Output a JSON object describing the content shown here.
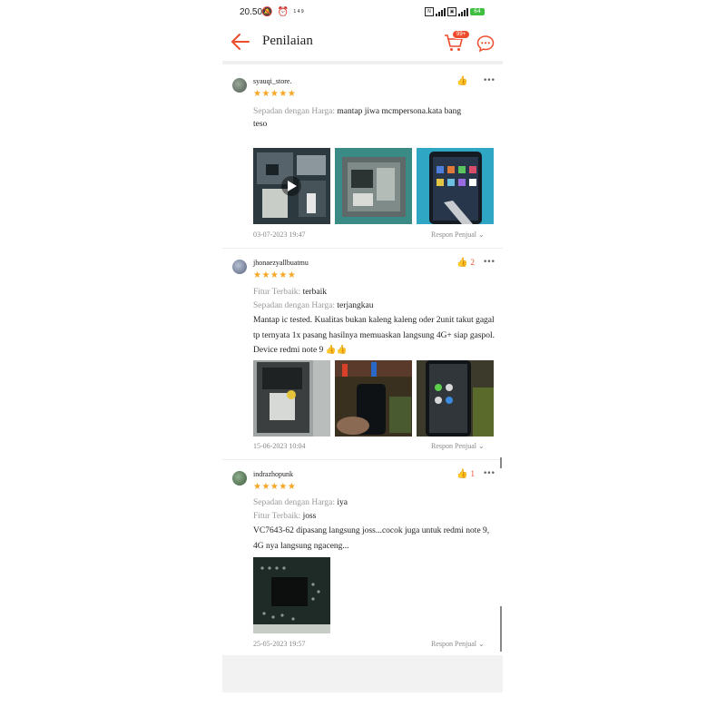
{
  "status_bar": {
    "time": "20.50",
    "indicator": "149",
    "battery": "64"
  },
  "header": {
    "title": "Penilaian",
    "cart_badge": "99+"
  },
  "reviews": [
    {
      "username": "syauqi_store.",
      "stars": "★★★★★",
      "rating_count": 5,
      "helpful_count": "",
      "lines": [
        {
          "key": "Sepadan dengan Harga:",
          "value": "mantap jiwa mcmpersona.kata bang"
        }
      ],
      "body": "teso",
      "date": "03-07-2023 19:47",
      "respon": "Respon Penjual"
    },
    {
      "username": "jhonaezyallbuatmu",
      "stars": "★★★★★",
      "rating_count": 5,
      "helpful_count": "2",
      "lines": [
        {
          "key": "Fitur Terbaik:",
          "value": "terbaik"
        },
        {
          "key": "Sepadan dengan Harga:",
          "value": "terjangkau"
        }
      ],
      "body": "Mantap ic tested. Kualitas bukan kaleng kaleng oder 2unit takut gagal tp ternyata 1x pasang hasilnya  memuaskan langsung 4G+ siap gaspol. Device redmi note 9 👍👍",
      "date": "15-06-2023 10:04",
      "respon": "Respon Penjual"
    },
    {
      "username": "indrazhopunk",
      "stars": "★★★★★",
      "rating_count": 5,
      "helpful_count": "1",
      "lines": [
        {
          "key": "Sepadan dengan Harga:",
          "value": "iya"
        },
        {
          "key": "Fitur Terbaik:",
          "value": "joss"
        }
      ],
      "body": "VC7643-62 dipasang langsung joss...cocok juga untuk redmi note 9, 4G nya langsung ngaceng...",
      "date": "25-05-2023 19:57",
      "respon": "Respon Penjual"
    }
  ],
  "icons": {
    "back": "arrow-left-icon",
    "cart": "cart-icon",
    "chat": "chat-icon",
    "like": "thumbs-up-icon",
    "more": "more-dots-icon",
    "play": "play-icon"
  },
  "colors": {
    "accent": "#ee4d2d",
    "star": "#f5a623",
    "muted": "#999999"
  }
}
